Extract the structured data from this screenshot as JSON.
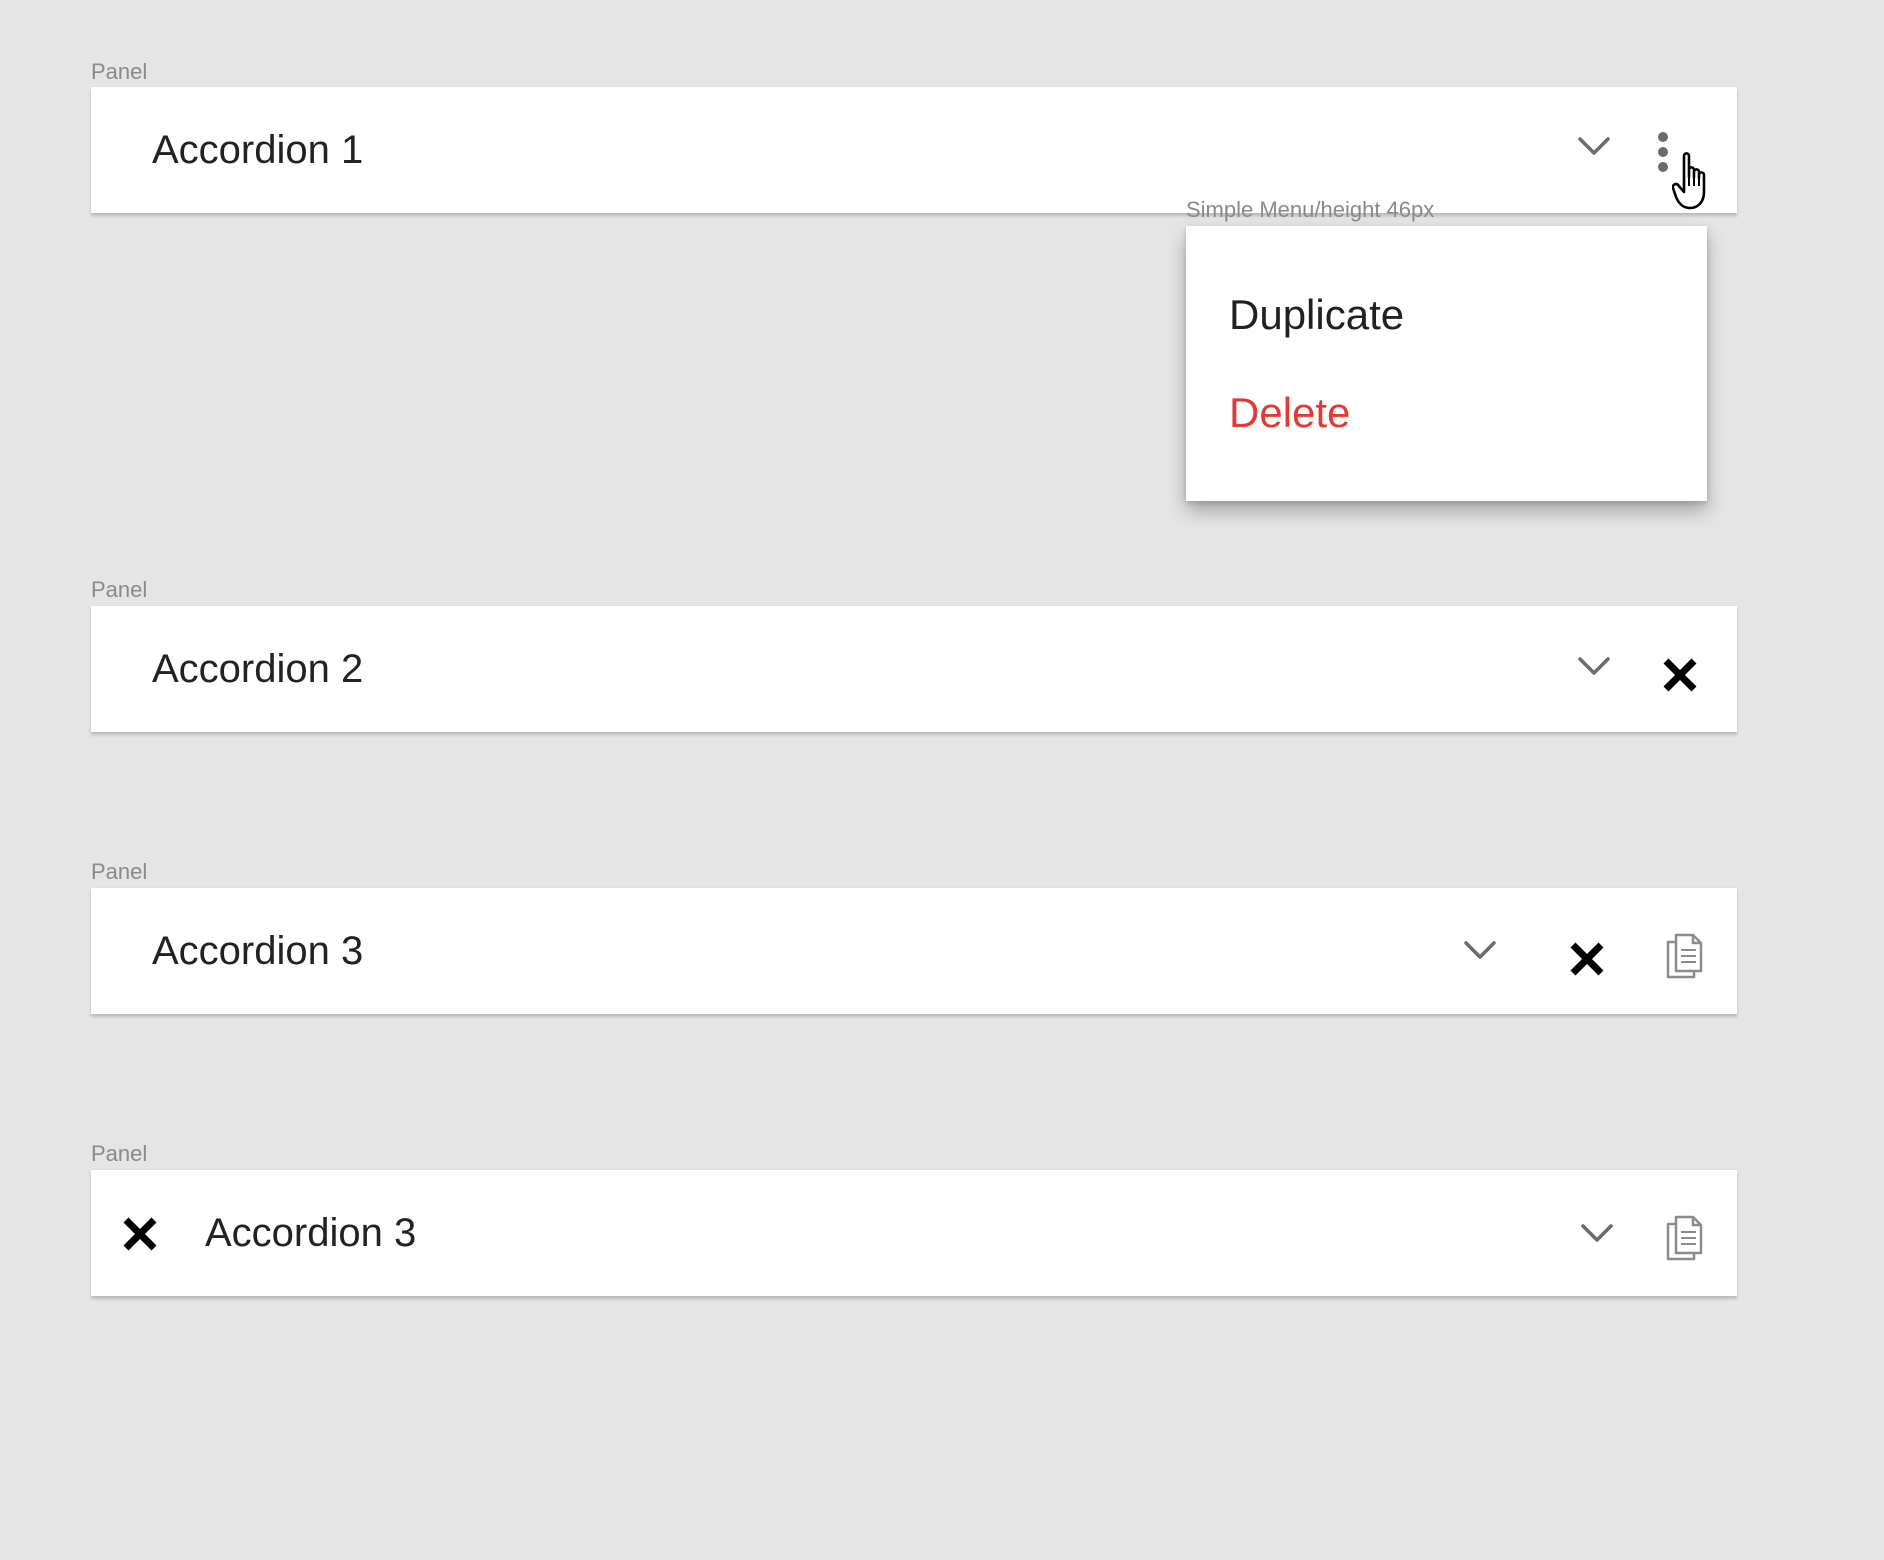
{
  "panels": [
    {
      "frame_label": "Panel",
      "title": "Accordion 1",
      "icons": [
        "chevron-down-icon",
        "more-vert-icon"
      ]
    },
    {
      "frame_label": "Panel",
      "title": "Accordion 2",
      "icons": [
        "chevron-down-icon",
        "close-icon"
      ]
    },
    {
      "frame_label": "Panel",
      "title": "Accordion 3",
      "icons": [
        "chevron-down-icon",
        "close-icon",
        "document-icon"
      ]
    },
    {
      "frame_label": "Panel",
      "title": "Accordion 3",
      "icons": [
        "close-icon",
        "chevron-down-icon",
        "document-icon"
      ]
    }
  ],
  "menu": {
    "frame_label": "Simple Menu/height 46px",
    "items": [
      {
        "label": "Duplicate",
        "color": "#212121"
      },
      {
        "label": "Delete",
        "color": "#e53935"
      }
    ]
  },
  "colors": {
    "background": "#e5e5e5",
    "panel": "#ffffff",
    "title_text": "#222222",
    "frame_label": "#8a8a8a",
    "chevron": "#6b6b6b",
    "close": "#000000",
    "document": "#8c8c8c",
    "delete": "#e53935"
  },
  "cursor": "hand-pointer-cursor"
}
